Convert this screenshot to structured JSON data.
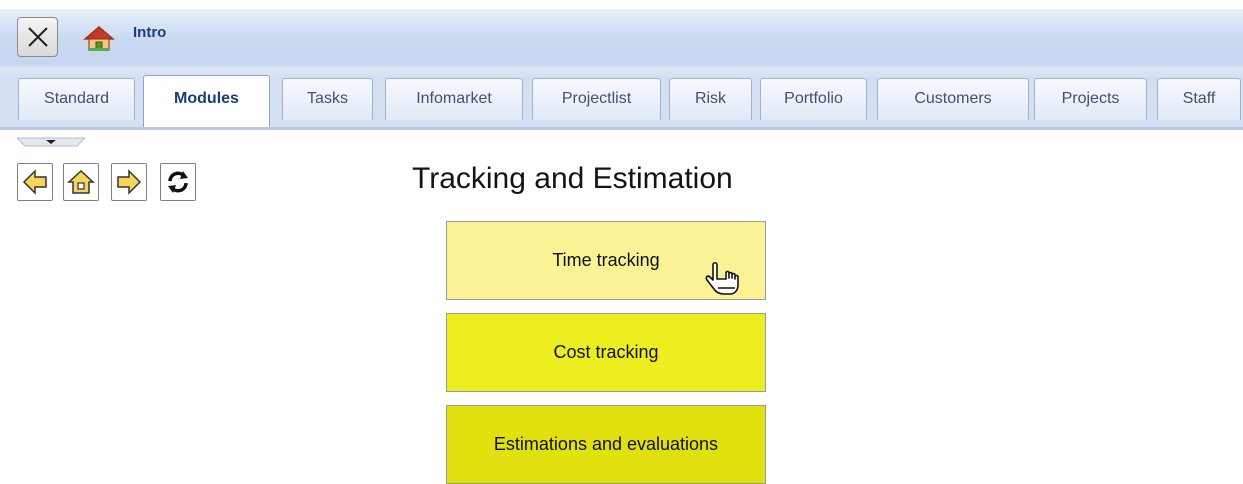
{
  "window": {
    "title": "Intro",
    "close_icon": "close-x-icon",
    "home_icon": "house-icon"
  },
  "tabs": [
    {
      "label": "Standard",
      "active": false
    },
    {
      "label": "Modules",
      "active": true
    },
    {
      "label": "Tasks",
      "active": false
    },
    {
      "label": "Infomarket",
      "active": false
    },
    {
      "label": "Projectlist",
      "active": false
    },
    {
      "label": "Risk",
      "active": false
    },
    {
      "label": "Portfolio",
      "active": false
    },
    {
      "label": "Customers",
      "active": false
    },
    {
      "label": "Projects",
      "active": false
    },
    {
      "label": "Staff",
      "active": false
    }
  ],
  "nav": {
    "back_icon": "arrow-left-icon",
    "home_icon": "home-icon",
    "forward_icon": "arrow-right-icon",
    "refresh_icon": "refresh-icon",
    "collapse_icon": "chevron-down-icon"
  },
  "main": {
    "heading": "Tracking and Estimation",
    "tiles": [
      {
        "label": "Time tracking",
        "color": "#fbf296",
        "state": "hover"
      },
      {
        "label": "Cost tracking",
        "color": "#edee1f",
        "state": "normal"
      },
      {
        "label": "Estimations and evaluations",
        "color": "#e1e10f",
        "state": "normal"
      }
    ]
  },
  "colors": {
    "accent": "#173e85",
    "tab_border": "#9fb2d4"
  }
}
